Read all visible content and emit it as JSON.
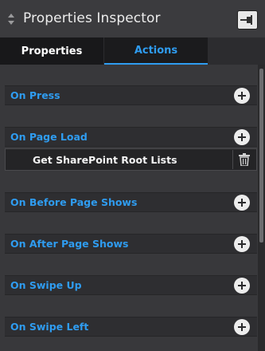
{
  "panel": {
    "title": "Properties Inspector",
    "grip_icon": "drag-handle-icon",
    "pin_icon": "pin-icon"
  },
  "tabs": [
    {
      "label": "Properties",
      "active": false
    },
    {
      "label": "Actions",
      "active": true
    }
  ],
  "events": [
    {
      "label": "On Press",
      "actions": []
    },
    {
      "label": "On Page Load",
      "actions": [
        {
          "label": "Get SharePoint Root Lists"
        }
      ]
    },
    {
      "label": "On Before Page Shows",
      "actions": []
    },
    {
      "label": "On After Page Shows",
      "actions": []
    },
    {
      "label": "On Swipe Up",
      "actions": []
    },
    {
      "label": "On Swipe Left",
      "actions": []
    }
  ],
  "colors": {
    "accent": "#2f9cf0",
    "panel_bg": "#38383b",
    "row_bg": "#2e2e31"
  }
}
